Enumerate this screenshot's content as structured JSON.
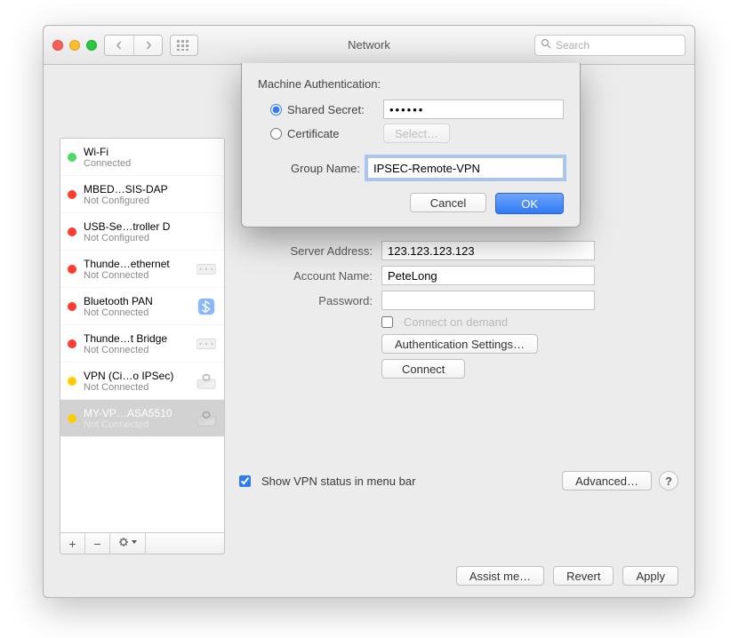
{
  "window": {
    "title": "Network",
    "search_placeholder": "Search"
  },
  "sidebar": {
    "items": [
      {
        "name": "Wi-Fi",
        "status": "Connected",
        "dot": "dot-g",
        "icon": "wifi"
      },
      {
        "name": "MBED…SIS-DAP",
        "status": "Not Configured",
        "dot": "dot-r",
        "icon": "none"
      },
      {
        "name": "USB-Se…troller D",
        "status": "Not Configured",
        "dot": "dot-r",
        "icon": "none"
      },
      {
        "name": "Thunde…ethernet",
        "status": "Not Connected",
        "dot": "dot-r",
        "icon": "tb"
      },
      {
        "name": "Bluetooth PAN",
        "status": "Not Connected",
        "dot": "dot-r",
        "icon": "bt"
      },
      {
        "name": "Thunde…t Bridge",
        "status": "Not Connected",
        "dot": "dot-r",
        "icon": "tb"
      },
      {
        "name": "VPN (Ci…o IPSec)",
        "status": "Not Connected",
        "dot": "dot-o",
        "icon": "lock"
      },
      {
        "name": "MY-VP…ASA5510",
        "status": "Not Connected",
        "dot": "dot-o",
        "icon": "lock",
        "selected": true
      }
    ],
    "add_label": "+",
    "remove_label": "−",
    "gear_label": "✻▾"
  },
  "main": {
    "server_address_label": "Server Address:",
    "server_address_value": "123.123.123.123",
    "account_name_label": "Account Name:",
    "account_name_value": "PeteLong",
    "password_label": "Password:",
    "password_value": "",
    "connect_on_demand_label": "Connect on demand",
    "connect_on_demand_checked": false,
    "auth_settings_label": "Authentication Settings…",
    "connect_label": "Connect",
    "show_status_label": "Show VPN status in menu bar",
    "show_status_checked": true,
    "advanced_label": "Advanced…"
  },
  "footer": {
    "assist_label": "Assist me…",
    "revert_label": "Revert",
    "apply_label": "Apply"
  },
  "sheet": {
    "heading": "Machine Authentication:",
    "shared_secret_label": "Shared Secret:",
    "shared_secret_value": "••••••",
    "shared_secret_checked": true,
    "certificate_label": "Certificate",
    "certificate_select_label": "Select…",
    "group_name_label": "Group Name:",
    "group_name_value": "IPSEC-Remote-VPN",
    "cancel_label": "Cancel",
    "ok_label": "OK"
  }
}
